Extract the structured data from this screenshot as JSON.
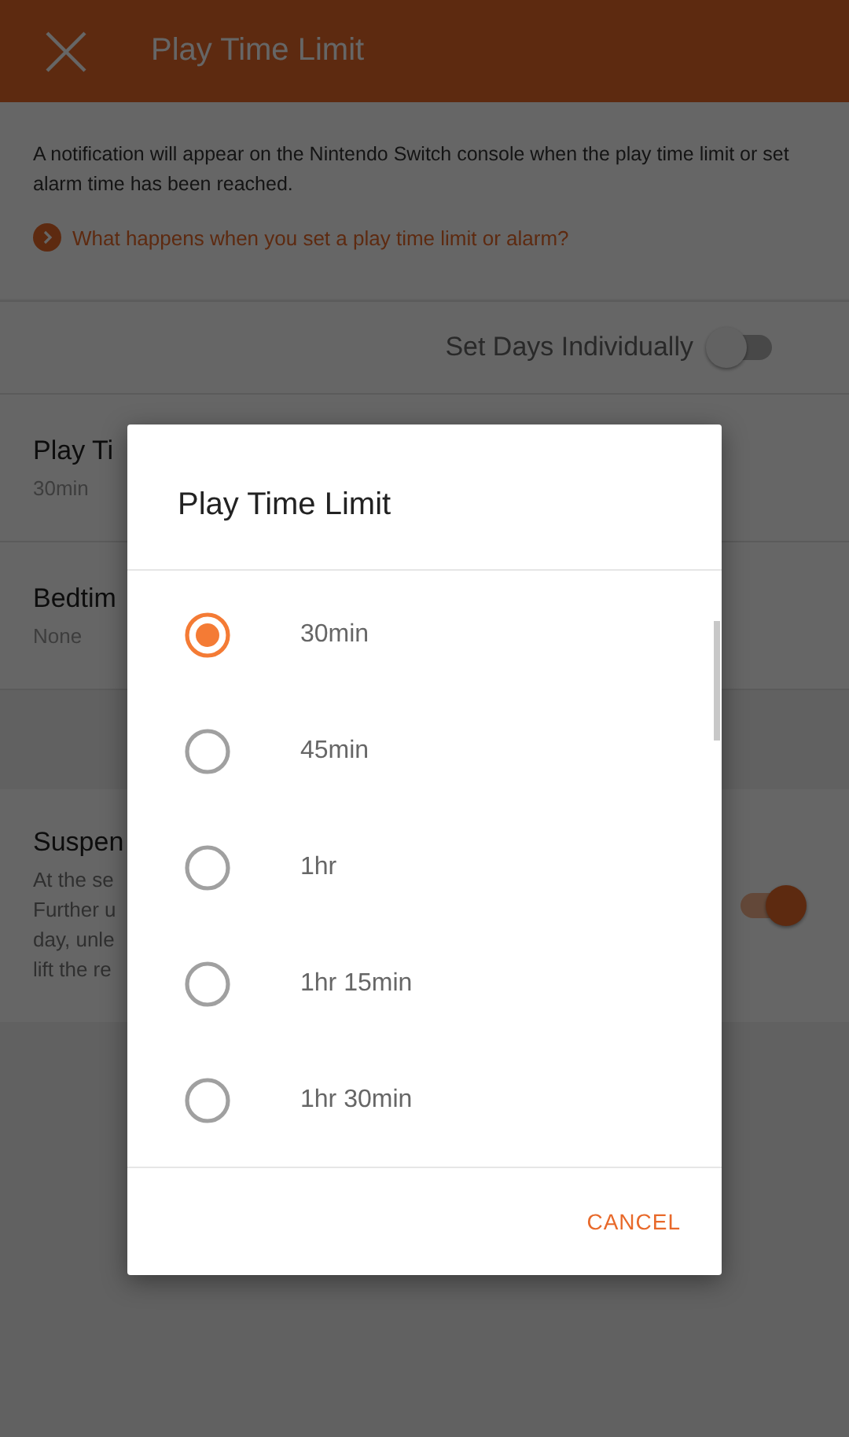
{
  "header": {
    "title": "Play Time Limit"
  },
  "info": {
    "text": "A notification will appear on the Nintendo Switch console when the play time limit or set alarm time has been reached.",
    "link": "What happens when you set a play time limit or alarm?"
  },
  "set_days": {
    "label": "Set Days Individually",
    "on": false
  },
  "settings": [
    {
      "title": "Play Ti",
      "value": "30min"
    },
    {
      "title": "Bedtim",
      "value": "None"
    }
  ],
  "suspend": {
    "title": "Suspen",
    "lines": [
      "At the se",
      "Further u",
      "day, unle",
      "lift the re"
    ],
    "on": true
  },
  "dialog": {
    "title": "Play Time Limit",
    "options": [
      {
        "label": "30min",
        "selected": true
      },
      {
        "label": "45min",
        "selected": false
      },
      {
        "label": "1hr",
        "selected": false
      },
      {
        "label": "1hr 15min",
        "selected": false
      },
      {
        "label": "1hr 30min",
        "selected": false
      }
    ],
    "cancel": "CANCEL"
  }
}
